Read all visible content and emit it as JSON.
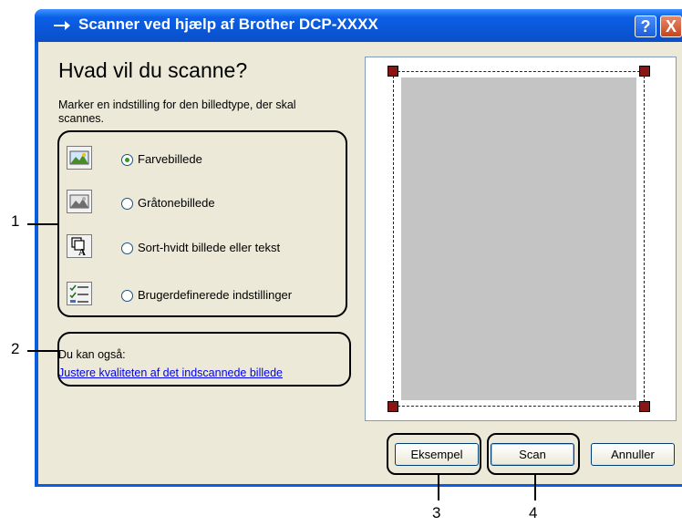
{
  "window": {
    "title": "Scanner ved hjælp af Brother DCP-XXXX",
    "help_label": "?",
    "close_label": "X"
  },
  "main": {
    "heading": "Hvad vil du scanne?",
    "instruction": "Marker en indstilling for den billedtype, der skal scannes.",
    "options": [
      {
        "label": "Farvebillede",
        "selected": true,
        "icon": "color-photo-icon"
      },
      {
        "label": "Gråtonebillede",
        "selected": false,
        "icon": "grayscale-photo-icon"
      },
      {
        "label": "Sort-hvidt billede eller tekst",
        "selected": false,
        "icon": "bw-text-icon"
      },
      {
        "label": "Brugerdefinerede indstillinger",
        "selected": false,
        "icon": "custom-settings-icon"
      }
    ],
    "also_label": "Du kan også:",
    "adjust_link": "Justere kvaliteten af det indscannede billede"
  },
  "buttons": {
    "preview": "Eksempel",
    "scan": "Scan",
    "cancel": "Annuller"
  },
  "callouts": [
    "1",
    "2",
    "3",
    "4"
  ],
  "colors": {
    "title_bar": "#0a5de0",
    "dialog_bg": "#ece9d8",
    "crop_handle": "#8b1515",
    "link": "#0000ee"
  }
}
